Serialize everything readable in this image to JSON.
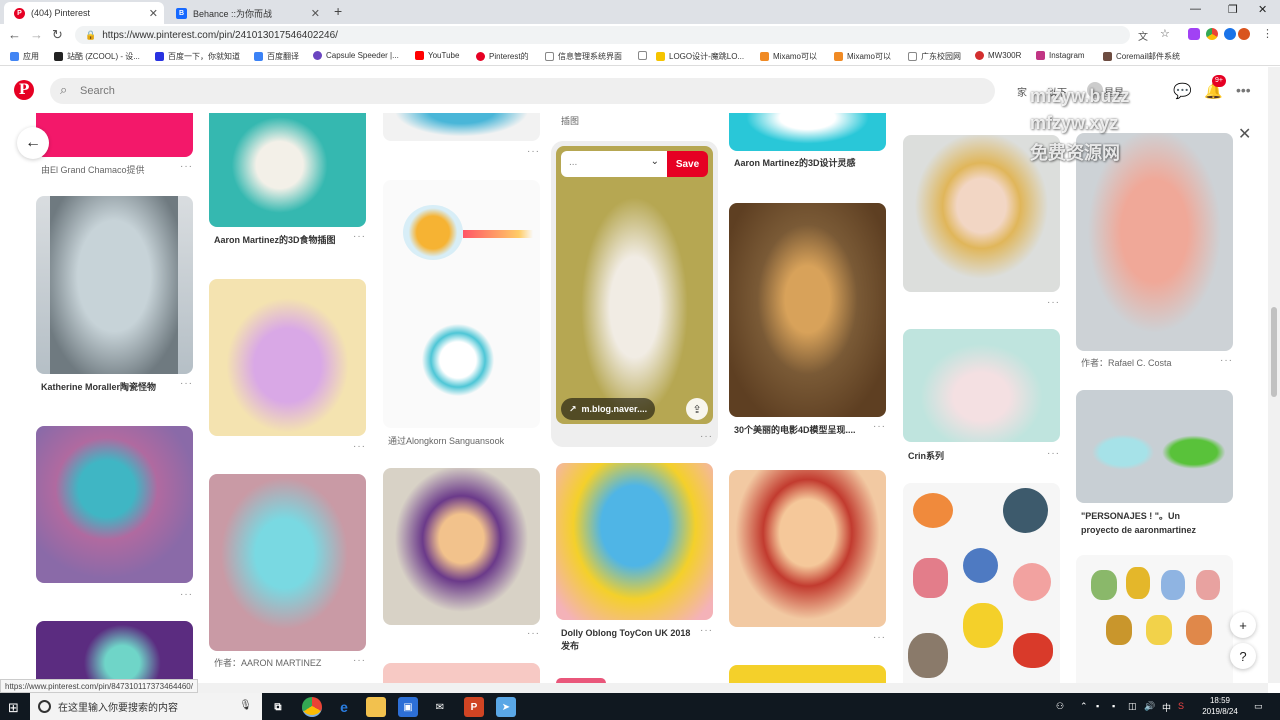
{
  "browser": {
    "tabs": [
      {
        "title": "(404) Pinterest",
        "icon": "pinterest-icon",
        "active": true
      },
      {
        "title": "Behance ::为你而战",
        "icon": "behance-icon",
        "active": false
      }
    ],
    "new_tab": "+",
    "url": "https://www.pinterest.com/pin/241013017546402246/",
    "bookmarks": [
      "应用",
      "站酷 (ZCOOL) - 设...",
      "百度一下，你就知道",
      "百度翻译",
      "Capsule Speeder |...",
      "YouTube",
      "Pinterest的",
      "信息管理系统界面",
      "LOGO设计-魔跳LO...",
      "Mixamo可以",
      "Mixamo可以",
      "广东校园网",
      "MW300R",
      "Instagram",
      "Coremail邮件系统"
    ]
  },
  "pinterest": {
    "logo": "P",
    "search_placeholder": "Search",
    "nav": {
      "home": "家",
      "following": "以下",
      "profile": "星星"
    },
    "notification_count": "9+",
    "watermarks": [
      "mfzyw.buzz",
      "mfzyw.xyz",
      "免费资源网"
    ],
    "save_overlay": {
      "board": "...",
      "save": "Save",
      "source": "m.blog.naver...."
    },
    "fab_plus": "+",
    "fab_help": "?",
    "captions": {
      "c1a": "由El Grand Chamaco提供",
      "c1b": "Katherine Moraller陶瓷怪物",
      "c2a": "Aaron Martinez的3D食物插图",
      "c2b": "作者：AARON MARTINEZ",
      "c3a": "通过Alongkorn Sanguansook",
      "c4top": "插图",
      "c4a": "Dolly Oblong ToyCon UK 2018",
      "c4b": "发布",
      "c5a": "Aaron Martinez的3D设计灵感",
      "c5b": "30个美丽的电影4D模型呈现....",
      "c6a": "Crin系列",
      "c7a": "作者：Rafael C. Costa",
      "c7b": "\"PERSONAJES ! \"。Un",
      "c7c": "proyecto de aaronmartinez"
    },
    "pin_colors": {
      "pink": "#f3186a",
      "teal": "#35b8b0",
      "cream": "#f4e3b0",
      "mauve": "#c99aa5",
      "purple": "#8a6aa8",
      "mustard": "#b6a752",
      "cyan": "#29c7d8",
      "bronze": "#7a5a36",
      "peach": "#f2c9a2",
      "yellow": "#f4d02a",
      "mint": "#bfe4de",
      "stone": "#c8cfd4"
    }
  },
  "status_link": "https://www.pinterest.com/pin/847310117373464460/",
  "taskbar": {
    "search_text": "在这里输入你要搜索的内容",
    "ime": "中",
    "time": "18:59",
    "date": "2019/8/24"
  }
}
